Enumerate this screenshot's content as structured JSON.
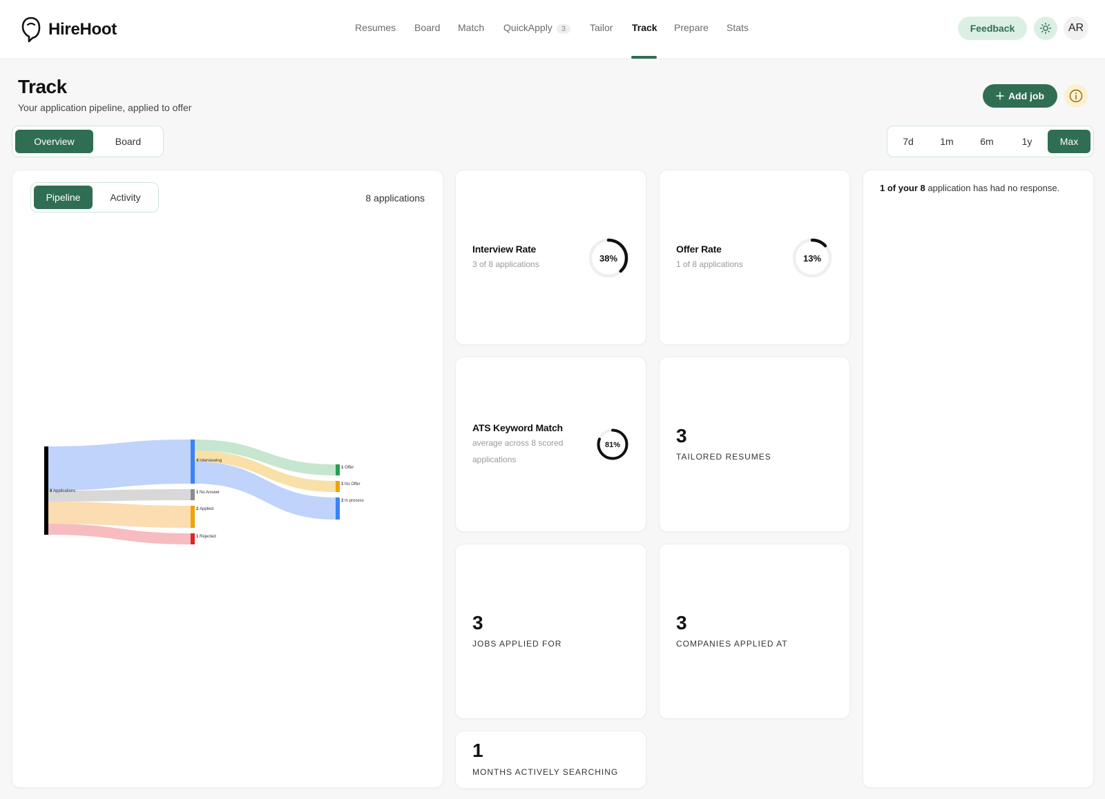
{
  "app": {
    "name": "HireHoot"
  },
  "nav": {
    "items": [
      {
        "label": "Resumes"
      },
      {
        "label": "Board"
      },
      {
        "label": "Match"
      },
      {
        "label": "QuickApply",
        "badge": "3"
      },
      {
        "label": "Tailor"
      },
      {
        "label": "Track",
        "active": true
      },
      {
        "label": "Prepare"
      },
      {
        "label": "Stats"
      }
    ],
    "feedback_label": "Feedback",
    "avatar_initials": "AR"
  },
  "page": {
    "title": "Track",
    "subtitle": "Your application pipeline, applied to offer",
    "add_job_label": "Add job"
  },
  "view_tabs": [
    {
      "label": "Overview",
      "active": true
    },
    {
      "label": "Board",
      "active": false
    }
  ],
  "range_tabs": [
    {
      "label": "7d",
      "active": false
    },
    {
      "label": "1m",
      "active": false
    },
    {
      "label": "6m",
      "active": false
    },
    {
      "label": "1y",
      "active": false
    },
    {
      "label": "Max",
      "active": true
    }
  ],
  "pipeline_card": {
    "tabs": [
      {
        "label": "Pipeline",
        "active": true
      },
      {
        "label": "Activity",
        "active": false
      }
    ],
    "count_label": "8 applications",
    "sankey": {
      "nodes": [
        {
          "id": "applications",
          "label": "Applications",
          "value": 8,
          "color": "#000000"
        },
        {
          "id": "interviewing",
          "label": "Interviewing",
          "value": 4,
          "color": "#3b82f6"
        },
        {
          "id": "no_answer",
          "label": "No Answer",
          "value": 1,
          "color": "#8c8c8c"
        },
        {
          "id": "applied",
          "label": "Applied",
          "value": 2,
          "color": "#f0a20a"
        },
        {
          "id": "rejected",
          "label": "Rejected",
          "value": 1,
          "color": "#e02424"
        },
        {
          "id": "offer",
          "label": "Offer",
          "value": 1,
          "color": "#22a052"
        },
        {
          "id": "no_offer",
          "label": "No Offer",
          "value": 1,
          "color": "#f0a20a"
        },
        {
          "id": "in_process",
          "label": "In process",
          "value": 2,
          "color": "#3b82f6"
        }
      ],
      "links": [
        {
          "source": "applications",
          "target": "interviewing",
          "value": 4,
          "color": "#bfd3fb"
        },
        {
          "source": "applications",
          "target": "no_answer",
          "value": 1,
          "color": "#d8d8d8"
        },
        {
          "source": "applications",
          "target": "applied",
          "value": 2,
          "color": "#fbddb1"
        },
        {
          "source": "applications",
          "target": "rejected",
          "value": 1,
          "color": "#f6bcbf"
        },
        {
          "source": "interviewing",
          "target": "offer",
          "value": 1,
          "color": "#c6e6cf"
        },
        {
          "source": "interviewing",
          "target": "no_offer",
          "value": 1,
          "color": "#f8e0a8"
        },
        {
          "source": "interviewing",
          "target": "in_process",
          "value": 2,
          "color": "#bfd3fb"
        }
      ]
    }
  },
  "metrics": {
    "interview_rate": {
      "title": "Interview Rate",
      "sub": "3 of 8 applications",
      "percent": 38,
      "percent_label": "38%"
    },
    "offer_rate": {
      "title": "Offer Rate",
      "sub": "1 of 8 applications",
      "percent": 13,
      "percent_label": "13%"
    },
    "ats_match": {
      "title": "ATS Keyword Match",
      "sub": "average across 8 scored applications",
      "percent": 81,
      "percent_label": "81%"
    },
    "tailored": {
      "value": "3",
      "label": "TAILORED RESUMES"
    },
    "jobs_applied": {
      "value": "3",
      "label": "JOBS APPLIED FOR"
    },
    "companies": {
      "value": "3",
      "label": "COMPANIES APPLIED AT"
    },
    "months": {
      "value": "1",
      "label": "MONTHS ACTIVELY SEARCHING"
    }
  },
  "insight": {
    "bold": "1 of your 8",
    "rest": " application has had no response."
  },
  "colors": {
    "accent": "#2f6e53",
    "accent_light": "#dcefe4"
  }
}
